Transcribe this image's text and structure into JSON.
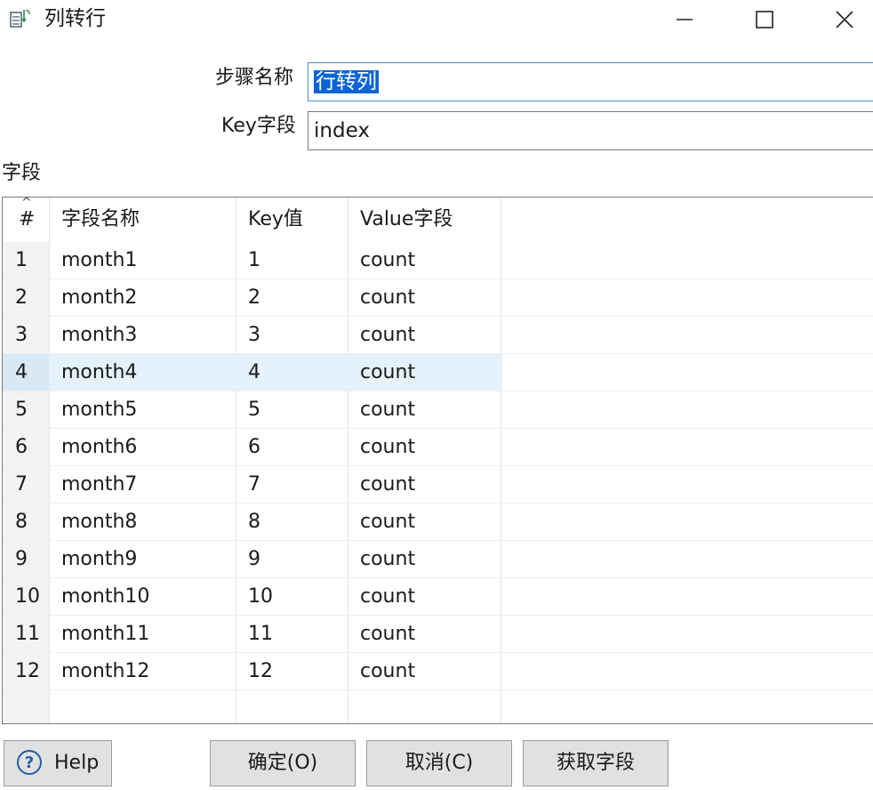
{
  "window": {
    "title": "列转行"
  },
  "form": {
    "step_name_label": "步骤名称",
    "step_name_value": "行转列",
    "key_field_label": "Key字段",
    "key_field_value": "index",
    "fields_section_label": "字段"
  },
  "table": {
    "headers": [
      "#",
      "字段名称",
      "Key值",
      "Value字段"
    ],
    "selected_row": 4,
    "rows": [
      {
        "num": "1",
        "name": "month1",
        "key": "1",
        "value": "count"
      },
      {
        "num": "2",
        "name": "month2",
        "key": "2",
        "value": "count"
      },
      {
        "num": "3",
        "name": "month3",
        "key": "3",
        "value": "count"
      },
      {
        "num": "4",
        "name": "month4",
        "key": "4",
        "value": "count"
      },
      {
        "num": "5",
        "name": "month5",
        "key": "5",
        "value": "count"
      },
      {
        "num": "6",
        "name": "month6",
        "key": "6",
        "value": "count"
      },
      {
        "num": "7",
        "name": "month7",
        "key": "7",
        "value": "count"
      },
      {
        "num": "8",
        "name": "month8",
        "key": "8",
        "value": "count"
      },
      {
        "num": "9",
        "name": "month9",
        "key": "9",
        "value": "count"
      },
      {
        "num": "10",
        "name": "month10",
        "key": "10",
        "value": "count"
      },
      {
        "num": "11",
        "name": "month11",
        "key": "11",
        "value": "count"
      },
      {
        "num": "12",
        "name": "month12",
        "key": "12",
        "value": "count"
      }
    ]
  },
  "buttons": {
    "help": "Help",
    "ok": "确定(O)",
    "cancel": "取消(C)",
    "get_fields": "获取字段"
  },
  "colors": {
    "selection": "#0a64d8",
    "row_highlight": "#e5f1fb",
    "help_icon": "#1f5fa8"
  }
}
